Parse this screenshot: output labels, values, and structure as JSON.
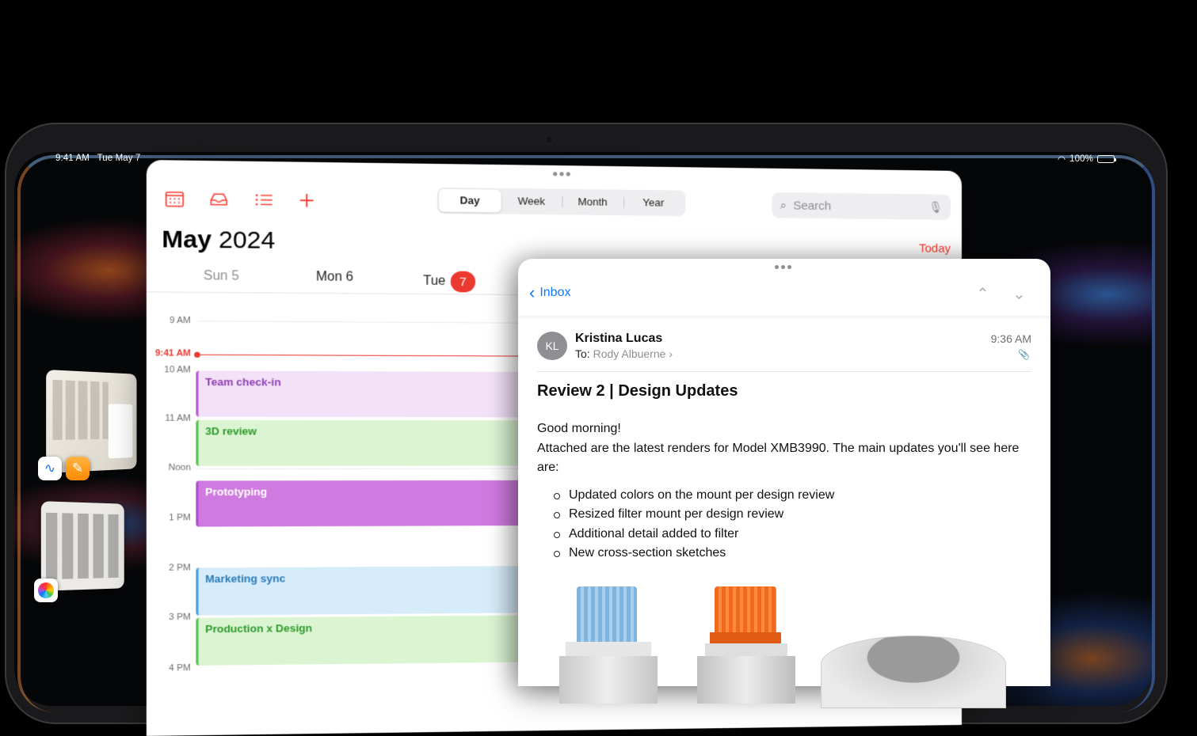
{
  "status_bar": {
    "time": "9:41 AM",
    "date": "Tue May 7",
    "battery": "100%",
    "battery_level": 1.0
  },
  "calendar": {
    "toolbar_icons": [
      "calendar-icon",
      "inbox-icon",
      "list-icon",
      "plus-icon"
    ],
    "view_segments": [
      {
        "label": "Day",
        "active": true
      },
      {
        "label": "Week",
        "active": false
      },
      {
        "label": "Month",
        "active": false
      },
      {
        "label": "Year",
        "active": false
      }
    ],
    "search_placeholder": "Search",
    "title_month": "May",
    "title_year": "2024",
    "today_label": "Today",
    "days": [
      {
        "label": "Sun 5"
      },
      {
        "label": "Mon 6"
      },
      {
        "label": "Tue",
        "badge": "7"
      }
    ],
    "time_labels": [
      "9 AM",
      "10 AM",
      "11 AM",
      "Noon",
      "1 PM",
      "2 PM",
      "3 PM",
      "4 PM"
    ],
    "now_label": "9:41 AM",
    "events": [
      {
        "title": "Team check-in",
        "color": "#bf5ae0"
      },
      {
        "title": "3D review",
        "color": "#5ac84f"
      },
      {
        "title": "Prototyping",
        "color": "#cf7ae0"
      },
      {
        "title": "Marketing sync",
        "color": "#4aa3e6"
      },
      {
        "title": "Production x Design",
        "color": "#5ac84f"
      }
    ]
  },
  "mail": {
    "back_label": "Inbox",
    "sender_initials": "KL",
    "sender_name": "Kristina Lucas",
    "to_label": "To:",
    "to_name": "Rody Albuerne",
    "time": "9:36 AM",
    "subject": "Review 2 | Design Updates",
    "greeting": "Good morning!",
    "intro": "Attached are the latest renders for Model XMB3990. The main updates you'll see here are:",
    "bullets": [
      "Updated colors on the mount per design review",
      "Resized filter mount per design review",
      "Additional detail added to filter",
      "New cross-section sketches"
    ]
  },
  "colors": {
    "accent_red": "#ea3a30",
    "link_blue": "#0a7aff"
  }
}
